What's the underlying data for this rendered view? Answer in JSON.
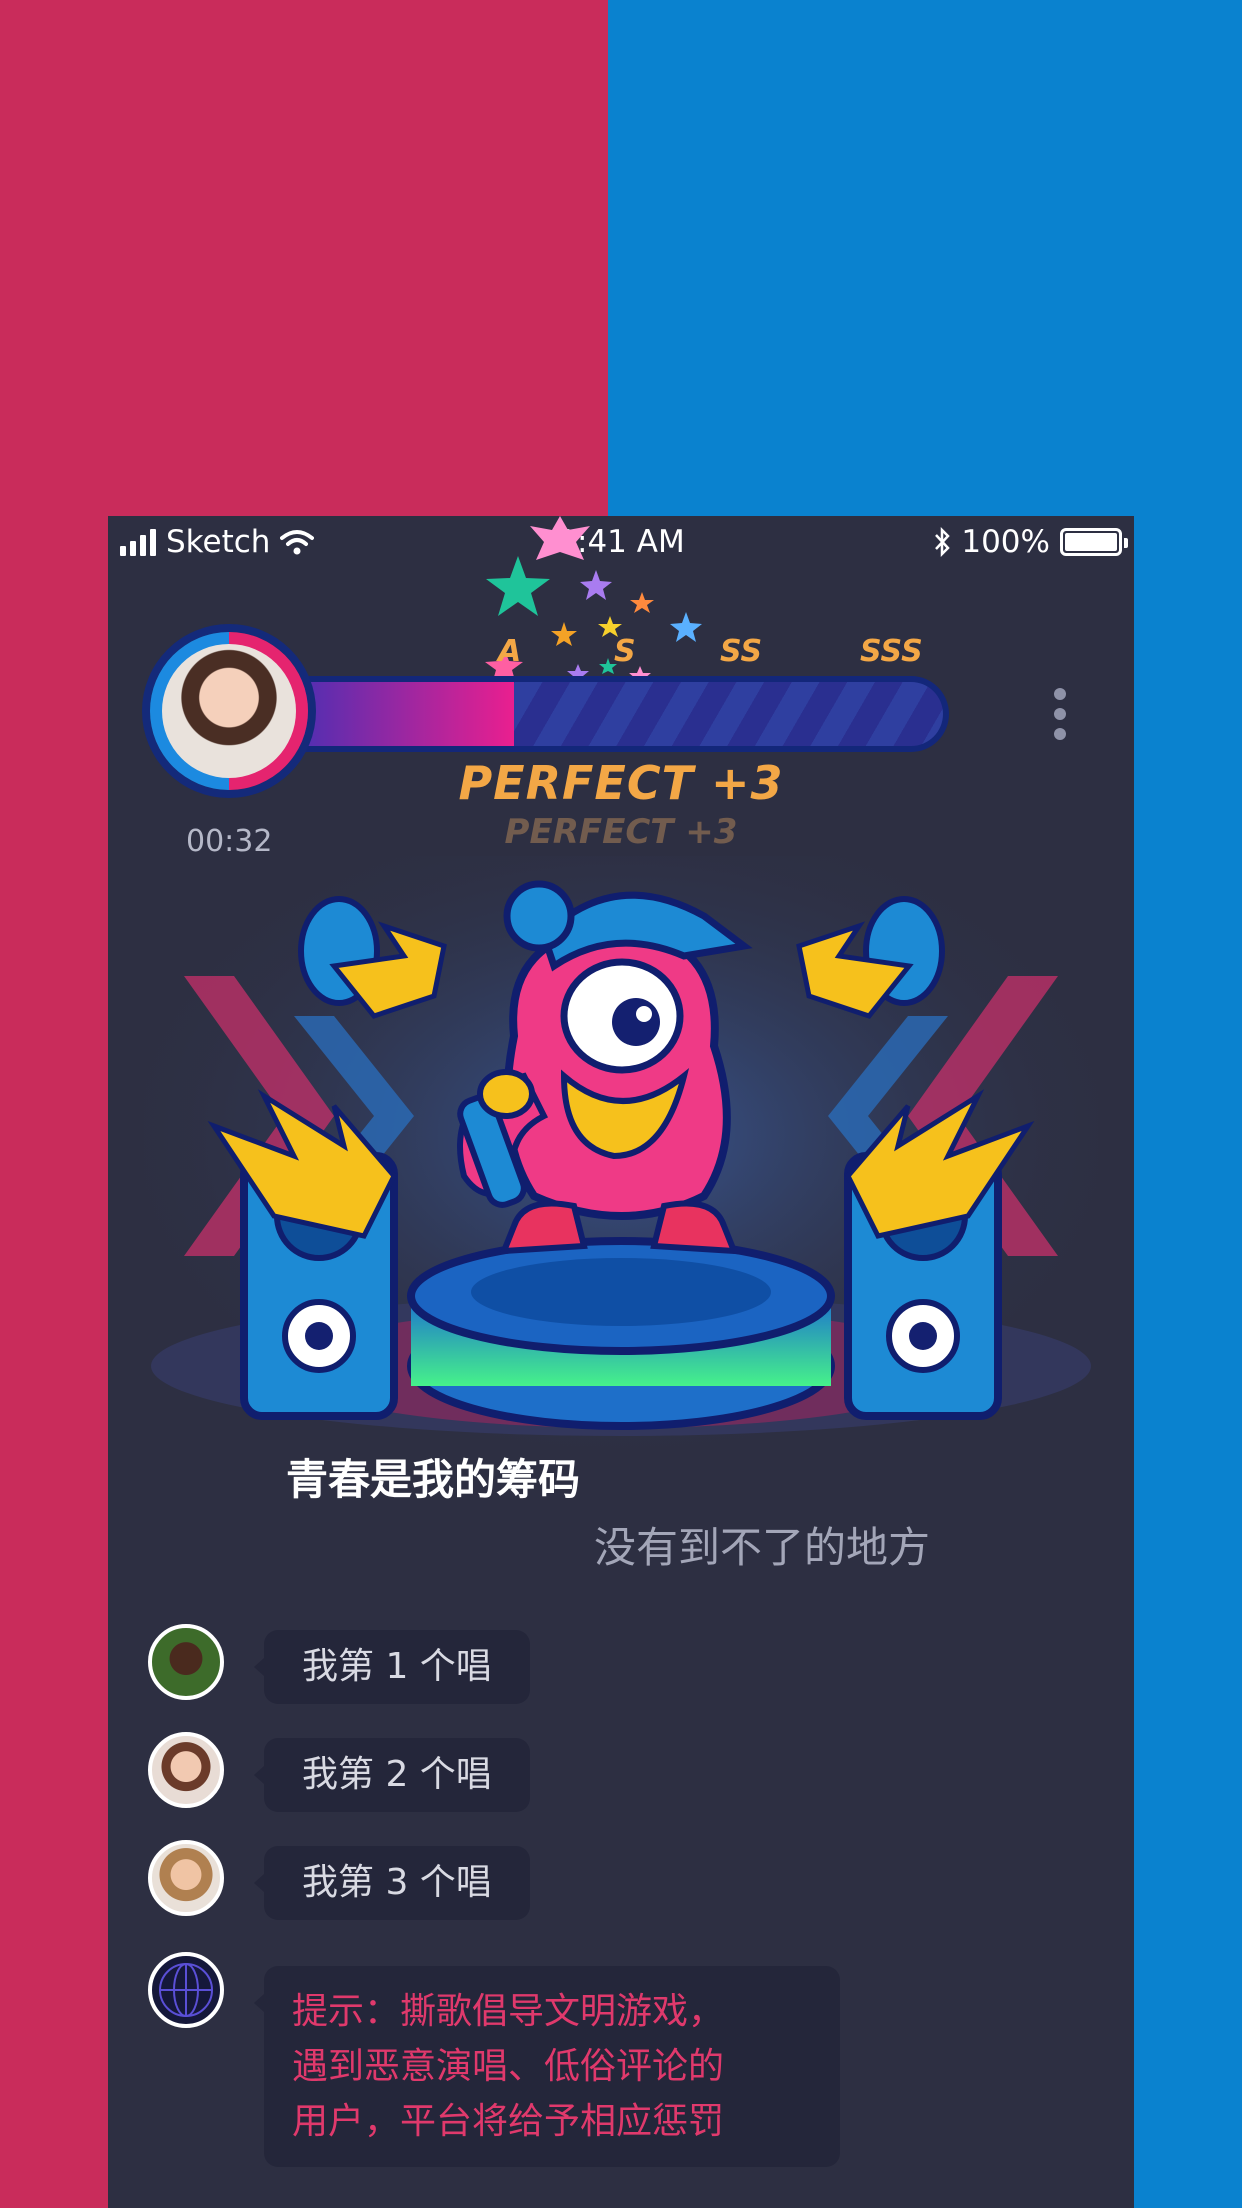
{
  "status_bar": {
    "carrier": "Sketch",
    "time": "9:41 AM",
    "battery": "100%"
  },
  "score": {
    "grades": [
      "A",
      "S",
      "SS",
      "SSS"
    ],
    "progress": 0.34,
    "timer": "00:32",
    "perfect": "PERFECT +3",
    "perfect_ghost": "PERFECT +3"
  },
  "lyrics": {
    "current": "青春是我的筹码",
    "next": "没有到不了的地方"
  },
  "queue": [
    {
      "label": "我第 1 个唱"
    },
    {
      "label": "我第 2 个唱"
    },
    {
      "label": "我第 3 个唱"
    }
  ],
  "tip": {
    "line1": "提示：撕歌倡导文明游戏，",
    "line2": "遇到恶意演唱、低俗评论的",
    "line3": "用户，平台将给予相应惩罚"
  },
  "colors": {
    "left_bg": "#c92c5b",
    "right_bg": "#0a82cf",
    "phone_bg": "#2d2f42",
    "grade": "#f3a746",
    "tip_text": "#e0396c"
  }
}
